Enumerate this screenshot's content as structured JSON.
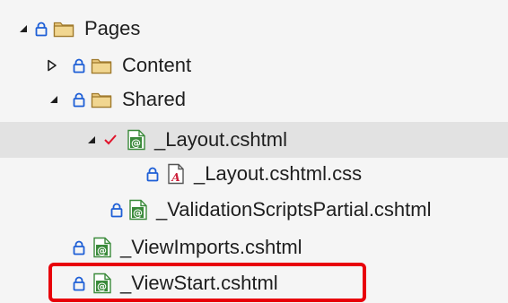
{
  "colors": {
    "background": "#f5f5f5",
    "selected_row": "#e2e2e2",
    "lock": "#1e5fd6",
    "folder_fill": "#e8c77d",
    "folder_stroke": "#a07a2c",
    "razor_green": "#3a8a3a",
    "check": "#e0142b",
    "highlight": "#e8000b"
  },
  "tree": [
    {
      "label": "Pages",
      "expander": "expanded",
      "icon": "folder-icon",
      "lock": true
    },
    {
      "label": "Content",
      "expander": "collapsed",
      "icon": "folder-icon",
      "lock": true
    },
    {
      "label": "Shared",
      "expander": "expanded",
      "icon": "folder-icon",
      "lock": true
    },
    {
      "label": "_Layout.cshtml",
      "expander": "expanded",
      "icon": "razor-file-icon",
      "status": "checked-out",
      "selected": true
    },
    {
      "label": "_Layout.cshtml.css",
      "icon": "css-file-icon",
      "lock": true
    },
    {
      "label": "_ValidationScriptsPartial.cshtml",
      "icon": "razor-file-icon",
      "lock": true
    },
    {
      "label": "_ViewImports.cshtml",
      "icon": "razor-file-icon",
      "lock": true
    },
    {
      "label": "_ViewStart.cshtml",
      "icon": "razor-file-icon",
      "lock": true,
      "highlighted": true
    }
  ]
}
